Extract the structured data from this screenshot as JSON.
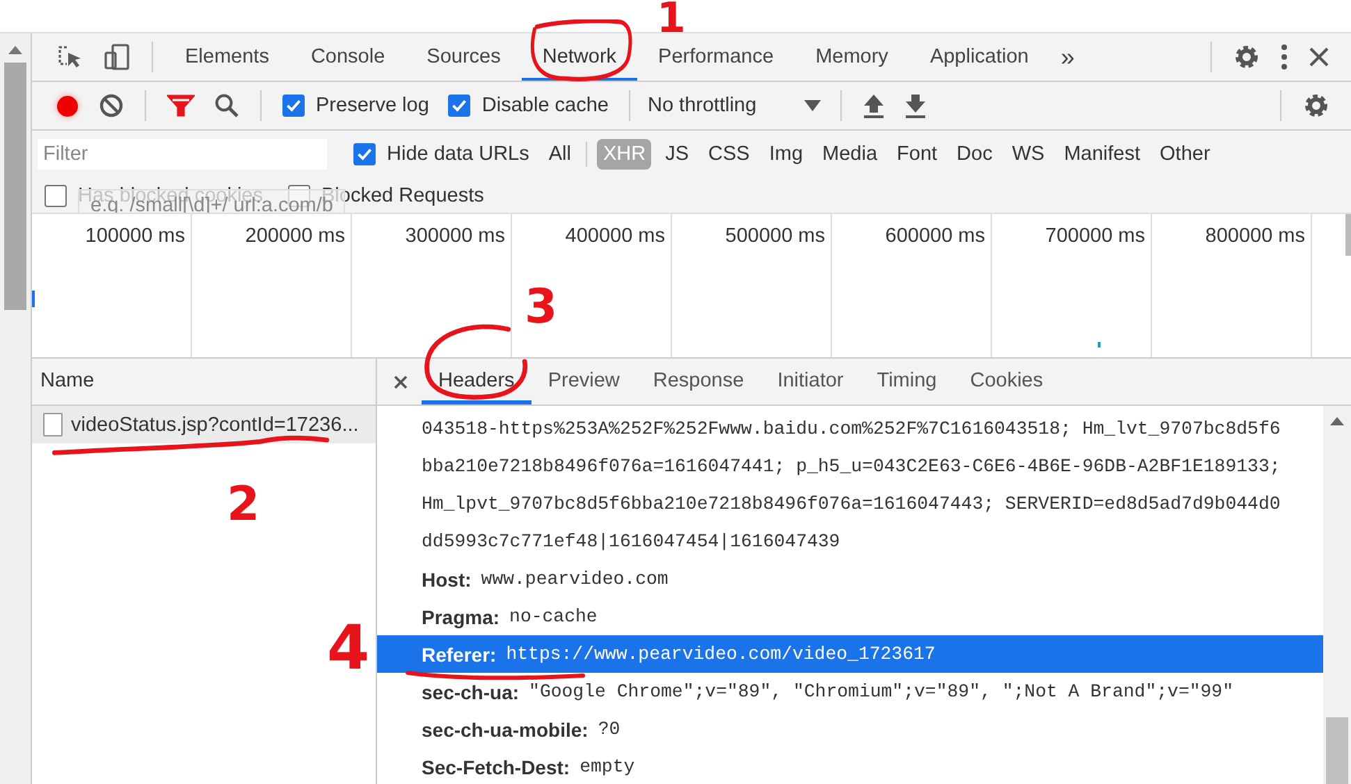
{
  "main_tabs": [
    {
      "label": "Elements",
      "selected": false
    },
    {
      "label": "Console",
      "selected": false
    },
    {
      "label": "Sources",
      "selected": false
    },
    {
      "label": "Network",
      "selected": true,
      "annotation": "1"
    },
    {
      "label": "Performance",
      "selected": false
    },
    {
      "label": "Memory",
      "selected": false
    },
    {
      "label": "Application",
      "selected": false
    }
  ],
  "more_tabs": "»",
  "toolbar": {
    "recording": true,
    "filter_active": true,
    "preserve_log": {
      "label": "Preserve log",
      "checked": true
    },
    "disable_cache": {
      "label": "Disable cache",
      "checked": true
    },
    "throttling": "No throttling"
  },
  "filter_bar": {
    "placeholder": "Filter",
    "hide_data_urls": {
      "label": "Hide data URLs",
      "checked": true
    },
    "all": "All",
    "types": [
      {
        "label": "XHR",
        "selected": true
      },
      {
        "label": "JS",
        "selected": false
      },
      {
        "label": "CSS",
        "selected": false
      },
      {
        "label": "Img",
        "selected": false
      },
      {
        "label": "Media",
        "selected": false
      },
      {
        "label": "Font",
        "selected": false
      },
      {
        "label": "Doc",
        "selected": false
      },
      {
        "label": "WS",
        "selected": false
      },
      {
        "label": "Manifest",
        "selected": false
      },
      {
        "label": "Other",
        "selected": false
      }
    ]
  },
  "options": [
    {
      "label": "Has blocked cookies",
      "checked": false
    },
    {
      "label": "Blocked Requests",
      "checked": false
    }
  ],
  "tooltip": "e.g. /small[\\d]+/ url:a.com/b",
  "timeline_ticks": [
    "100000 ms",
    "200000 ms",
    "300000 ms",
    "400000 ms",
    "500000 ms",
    "600000 ms",
    "700000 ms",
    "800000 ms"
  ],
  "requests": {
    "column": "Name",
    "rows": [
      {
        "name": "videoStatus.jsp?contId=17236...",
        "selected": true,
        "annotation": "2"
      }
    ]
  },
  "detail_tabs": [
    {
      "label": "Headers",
      "selected": true,
      "annotation": "3"
    },
    {
      "label": "Preview",
      "selected": false
    },
    {
      "label": "Response",
      "selected": false
    },
    {
      "label": "Initiator",
      "selected": false
    },
    {
      "label": "Timing",
      "selected": false
    },
    {
      "label": "Cookies",
      "selected": false
    }
  ],
  "cookie_lines": [
    "043518-https%253A%252F%252Fwww.baidu.com%252F%7C1616043518; Hm_lvt_9707bc8d5f6",
    "bba210e7218b8496f076a=1616047441; p_h5_u=043C2E63-C6E6-4B6E-96DB-A2BF1E189133;",
    "Hm_lpvt_9707bc8d5f6bba210e7218b8496f076a=1616047443; SERVERID=ed8d5ad7d9b044d0",
    "dd5993c7c771ef48|1616047454|1616047439"
  ],
  "headers": [
    {
      "name": "Host:",
      "value": "www.pearvideo.com",
      "selected": false
    },
    {
      "name": "Pragma:",
      "value": "no-cache",
      "selected": false
    },
    {
      "name": "Referer:",
      "value": "https://www.pearvideo.com/video_1723617",
      "selected": true,
      "annotation": "4"
    },
    {
      "name": "sec-ch-ua:",
      "value": "\"Google Chrome\";v=\"89\", \"Chromium\";v=\"89\", \";Not A Brand\";v=\"99\"",
      "selected": false
    },
    {
      "name": "sec-ch-ua-mobile:",
      "value": "?0",
      "selected": false
    },
    {
      "name": "Sec-Fetch-Dest:",
      "value": "empty",
      "selected": false
    }
  ]
}
